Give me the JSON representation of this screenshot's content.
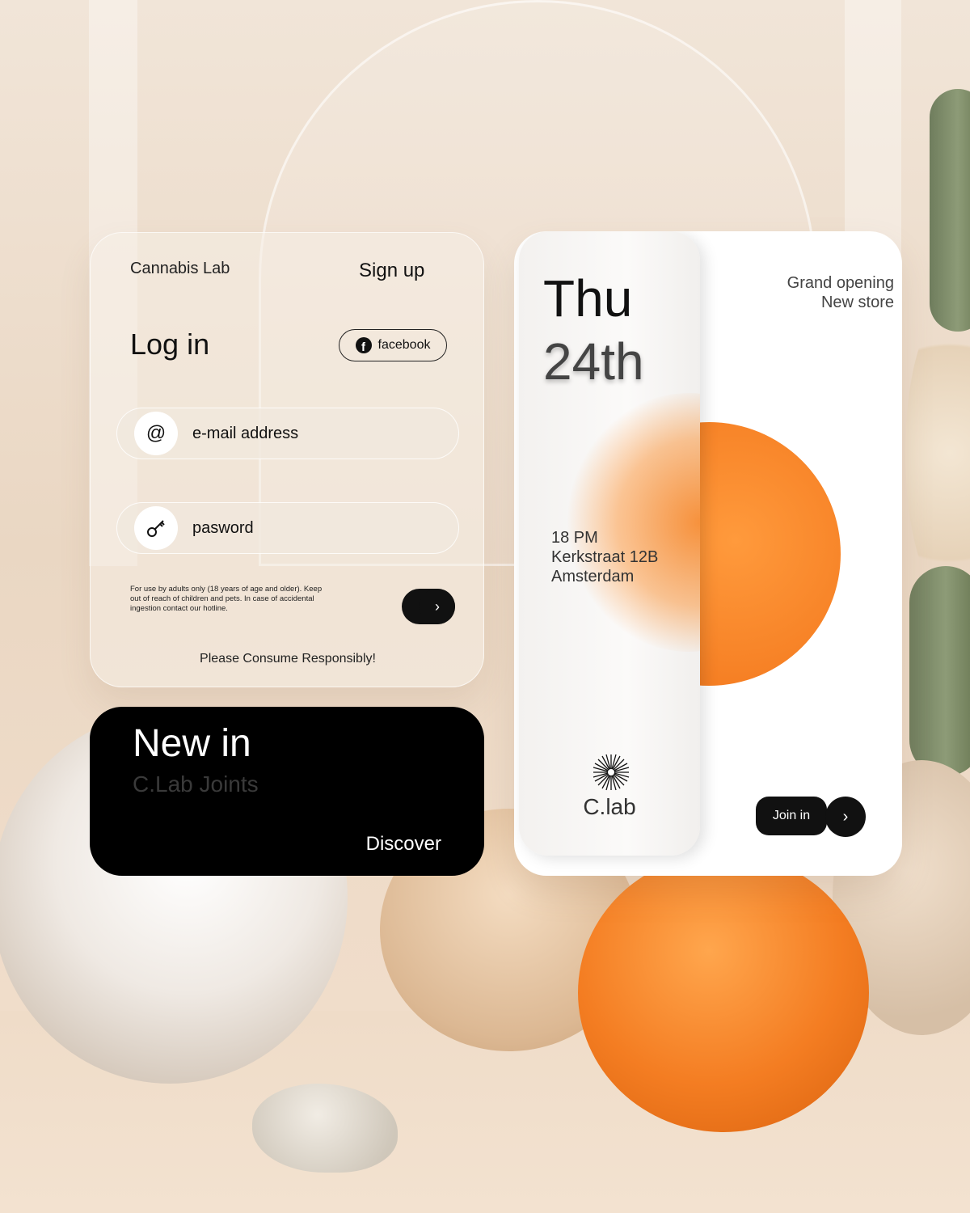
{
  "login": {
    "brand": "Cannabis Lab",
    "signup_label": "Sign up",
    "title": "Log in",
    "facebook_label": "facebook",
    "email_placeholder": "e-mail address",
    "password_placeholder": "pasword",
    "email_icon": "at-icon",
    "password_icon": "key-icon",
    "disclaimer": "For use by adults only (18 years of age and older). Keep out of reach of children and pets. In case of accidental ingestion contact our hotline.",
    "footer": "Please Consume Responsibly!"
  },
  "newin": {
    "title": "New in",
    "subtitle": "C.Lab Joints",
    "discover_label": "Discover"
  },
  "event": {
    "day": "Thu",
    "date": "24th",
    "time": "18 PM",
    "street": "Kerkstraat 12B",
    "city": "Amsterdam",
    "logo": "C.lab",
    "headline_1": "Grand opening",
    "headline_2": "New store",
    "join_label": "Join in",
    "accent_color": "#f47a1f"
  }
}
